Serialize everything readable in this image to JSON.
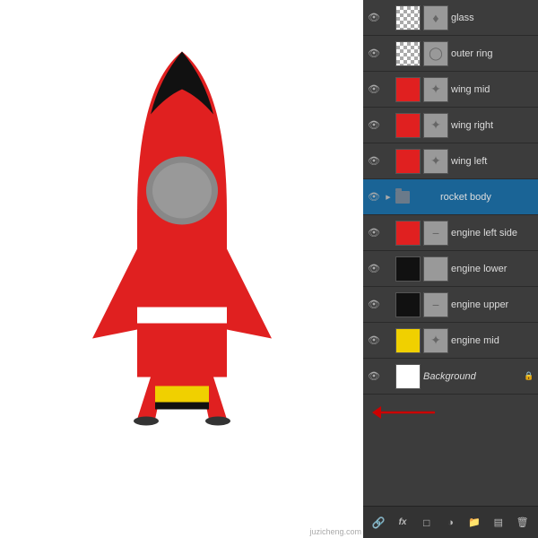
{
  "canvas": {
    "background": "#ffffff"
  },
  "layers": [
    {
      "id": "glass",
      "name": "glass",
      "visible": true,
      "thumb1": "checker",
      "thumb2": "gray",
      "icon": "♦",
      "active": false,
      "folder": false,
      "lock": false
    },
    {
      "id": "outer-ring",
      "name": "outer ring",
      "visible": true,
      "thumb1": "checker",
      "thumb2": "gray",
      "icon": "◯",
      "active": false,
      "folder": false,
      "lock": false
    },
    {
      "id": "wing-mid",
      "name": "wing mid",
      "visible": true,
      "thumb1": "red",
      "thumb2": "gray",
      "icon": "✦",
      "active": false,
      "folder": false,
      "lock": false
    },
    {
      "id": "wing-right",
      "name": "wing right",
      "visible": true,
      "thumb1": "red",
      "thumb2": "gray",
      "icon": "✦",
      "active": false,
      "folder": false,
      "lock": false
    },
    {
      "id": "wing-left",
      "name": "wing left",
      "visible": true,
      "thumb1": "red",
      "thumb2": "gray",
      "icon": "✦",
      "active": false,
      "folder": false,
      "lock": false
    },
    {
      "id": "rocket-body",
      "name": "rocket body",
      "visible": true,
      "thumb1": null,
      "thumb2": null,
      "icon": null,
      "active": true,
      "folder": true,
      "lock": false
    },
    {
      "id": "engine-left-side",
      "name": "engine left side",
      "visible": true,
      "thumb1": "red",
      "thumb2": "gray",
      "icon": "−",
      "active": false,
      "folder": false,
      "lock": false
    },
    {
      "id": "engine-lower",
      "name": "engine lower",
      "visible": true,
      "thumb1": "black",
      "thumb2": "gray",
      "icon": null,
      "active": false,
      "folder": false,
      "lock": false
    },
    {
      "id": "engine-upper",
      "name": "engine upper",
      "visible": true,
      "thumb1": "black",
      "thumb2": "gray",
      "icon": "−",
      "active": false,
      "folder": false,
      "lock": false
    },
    {
      "id": "engine-mid",
      "name": "engine mid",
      "visible": true,
      "thumb1": "yellow",
      "thumb2": "gray",
      "icon": "✦",
      "active": false,
      "folder": false,
      "lock": false
    },
    {
      "id": "background",
      "name": "Background",
      "visible": true,
      "thumb1": "white",
      "thumb2": null,
      "icon": null,
      "active": false,
      "folder": false,
      "lock": true
    }
  ],
  "toolbar": {
    "buttons": [
      "🔗",
      "fx",
      "□",
      "◉",
      "📁",
      "▤",
      "🗑"
    ]
  }
}
